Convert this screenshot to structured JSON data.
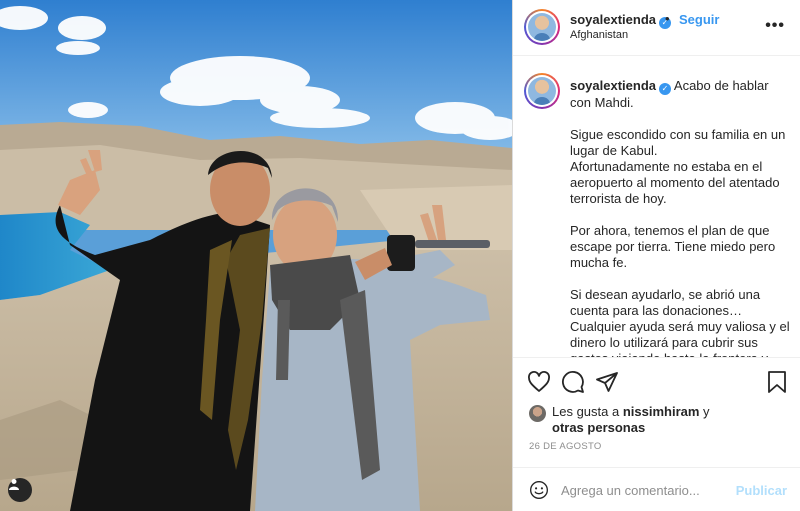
{
  "post": {
    "username": "soyalextienda",
    "follow_separator": "•",
    "follow_label": "Seguir",
    "location": "Afghanistan",
    "more_label": "•••",
    "caption": {
      "username": "soyalextienda",
      "first_line": " Acabo de hablar con Mahdi.",
      "paragraphs": [
        "Sigue escondido con su familia en un lugar de Kabul.\nAfortunadamente no estaba en el aeropuerto al momento del atentado terrorista de hoy.",
        "Por ahora, tenemos el plan de que escape por tierra. Tiene miedo pero mucha fe.",
        "Si desean ayudarlo, se abrió una cuenta para las donaciones…\nCualquier ayuda será muy valiosa y el dinero lo utilizará para cubrir sus gastos viajando hasta la frontera y"
      ]
    },
    "likes": {
      "prefix": "Les gusta a ",
      "user": "nissimhiram",
      "connector": " y",
      "others": "otras personas"
    },
    "date": "26 DE AGOSTO",
    "comment": {
      "placeholder": "Agrega un comentario...",
      "publish_label": "Publicar"
    }
  },
  "icons": {
    "verified": "verified-badge-icon",
    "like": "heart-icon",
    "comment": "comment-bubble-icon",
    "share": "paper-plane-icon",
    "save": "bookmark-icon",
    "emoji": "smiley-icon",
    "user_tag": "person-icon"
  },
  "colors": {
    "accent": "#3897f0",
    "text": "#262626",
    "muted": "#8e8e8e",
    "publish_disabled": "#b2dffc",
    "border": "#dbdbdb"
  }
}
